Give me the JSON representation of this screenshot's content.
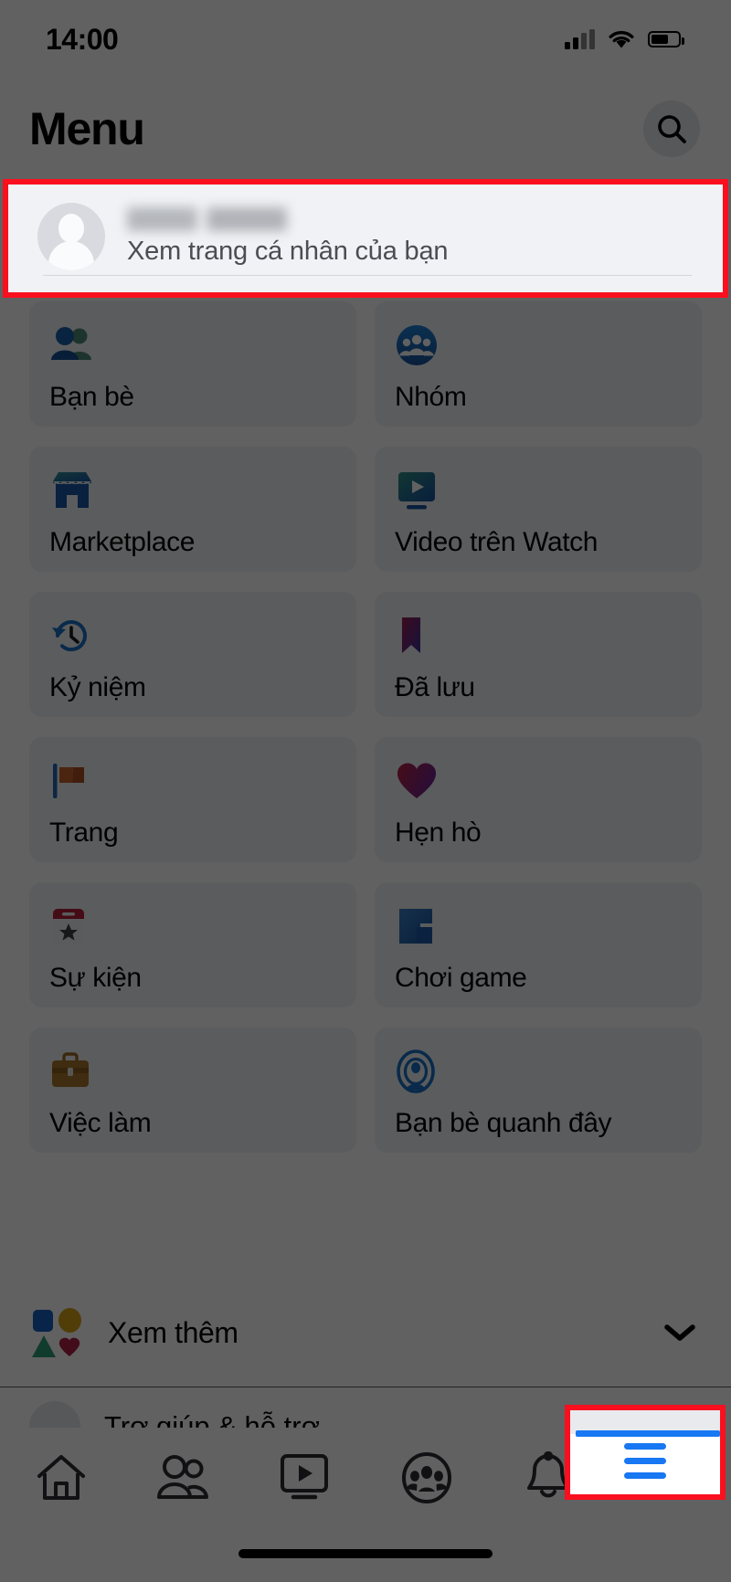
{
  "status_bar": {
    "time": "14:00",
    "signal_icon": "cellular-signal-icon",
    "wifi_icon": "wifi-icon",
    "battery_icon": "battery-icon"
  },
  "header": {
    "title": "Menu",
    "search_icon": "search-icon"
  },
  "profile": {
    "name": "",
    "subtitle": "Xem trang cá nhân của bạn",
    "avatar_icon": "default-avatar-icon",
    "highlighted": true,
    "highlight_color": "#fa0f1e"
  },
  "menu_grid": {
    "items": [
      {
        "label": "Bạn bè",
        "icon": "friends-icon"
      },
      {
        "label": "Nhóm",
        "icon": "groups-icon"
      },
      {
        "label": "Marketplace",
        "icon": "marketplace-icon"
      },
      {
        "label": "Video trên Watch",
        "icon": "watch-video-icon"
      },
      {
        "label": "Kỷ niệm",
        "icon": "memories-clock-icon"
      },
      {
        "label": "Đã lưu",
        "icon": "saved-bookmark-icon"
      },
      {
        "label": "Trang",
        "icon": "pages-flag-icon"
      },
      {
        "label": "Hẹn hò",
        "icon": "dating-heart-icon"
      },
      {
        "label": "Sự kiện",
        "icon": "events-calendar-icon"
      },
      {
        "label": "Chơi game",
        "icon": "gaming-icon"
      },
      {
        "label": "Việc làm",
        "icon": "jobs-briefcase-icon"
      },
      {
        "label": "Bạn bè quanh đây",
        "icon": "nearby-friends-icon"
      }
    ]
  },
  "see_more": {
    "label": "Xem thêm",
    "icon": "shapes-icon",
    "chevron_icon": "chevron-down-icon"
  },
  "cut_off_row": {
    "label": "Trợ giúp & hỗ trợ",
    "icon": "help-support-icon"
  },
  "bottom_nav": {
    "items": [
      {
        "label": "Trang chủ",
        "icon": "home-icon",
        "active": false
      },
      {
        "label": "Bạn bè",
        "icon": "friends-nav-icon",
        "active": false
      },
      {
        "label": "Watch",
        "icon": "watch-nav-icon",
        "active": false
      },
      {
        "label": "Nhóm",
        "icon": "groups-nav-icon",
        "active": false
      },
      {
        "label": "Thông báo",
        "icon": "bell-icon",
        "active": false
      },
      {
        "label": "Menu",
        "icon": "hamburger-menu-icon",
        "active": true
      }
    ],
    "active_indicator_color": "#1877f2",
    "highlight_color": "#fa0f1e"
  },
  "colors": {
    "accent": "#1877f2",
    "highlight": "#fa0f1e",
    "tile_bg": "#f0f2f5",
    "text": "#050505",
    "dim_overlay": "rgba(0,0,0,0.62)"
  }
}
